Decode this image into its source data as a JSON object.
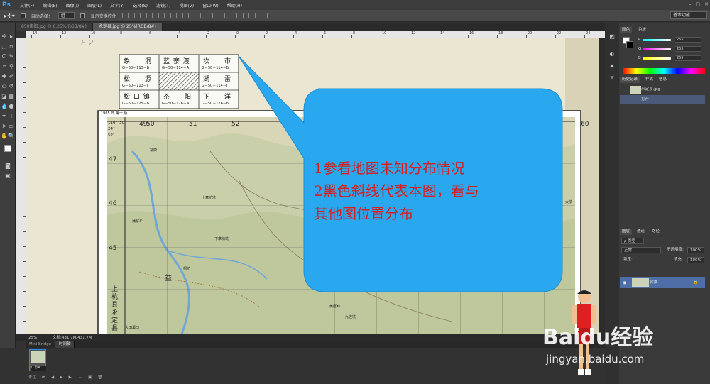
{
  "app": {
    "logo": "Ps",
    "menu": [
      "文件(F)",
      "编辑(E)",
      "图像(I)",
      "图层(L)",
      "文字(Y)",
      "选择(S)",
      "滤镜(T)",
      "视图(V)",
      "窗口(W)",
      "帮助(H)"
    ],
    "window_controls": [
      "–",
      "□",
      "✕"
    ]
  },
  "options": {
    "auto_select_label": "自动选择：",
    "auto_select_value": "组",
    "transform_label": "显示变换控件",
    "workspace": "基本功能"
  },
  "tabs": [
    {
      "label": "850崇阳.jpg @ 6.25%(RGB/8#)",
      "active": false
    },
    {
      "label": "永定县.jpg @ 25%(RGB/8#)",
      "active": true
    }
  ],
  "ruler_top": [
    "14",
    "12",
    "10",
    "8",
    "6",
    "4",
    "2",
    "0",
    "2",
    "4",
    "6",
    "8",
    "10",
    "12",
    "14",
    "16",
    "18",
    "20",
    "22",
    "24"
  ],
  "map": {
    "index_cells": [
      {
        "name": "象　　洞",
        "code": "G－50－113－Б"
      },
      {
        "name": "蓝 寨 渡",
        "code": "G－50－114－A"
      },
      {
        "name": "坎　　市",
        "code": "G－50－114－Б"
      },
      {
        "name": "松　　源",
        "code": "G－50－113－Г"
      },
      {
        "name": "",
        "code": ""
      },
      {
        "name": "湖　　雷",
        "code": "G－50－114－Г"
      },
      {
        "name": "松 口 镇",
        "code": "G－50－125－Б"
      },
      {
        "name": "茶　　阳",
        "code": "G－50－126－A"
      },
      {
        "name": "下　　洋",
        "code": "G－50－126－Б"
      }
    ],
    "year_label": "1965 年 第一 版",
    "corner_coords": [
      "116°",
      "30′",
      "24°",
      "52′"
    ],
    "grid_top": [
      "49",
      "50",
      "51",
      "52",
      "60"
    ],
    "grid_left": [
      "47",
      "46",
      "45"
    ],
    "side_text": [
      "上",
      "杭",
      "县",
      "永",
      "定",
      "县"
    ],
    "place_labels": [
      "上章坊坑",
      "下章坊坑",
      "桐坊",
      "益",
      "上杭县",
      "大田溪口",
      "蒲寨乡",
      "大侬",
      "黄厝畔",
      "九连坑",
      "寨康"
    ],
    "pencil_mark": "E 2"
  },
  "callout": {
    "line1": "1参看地图未知分布情况",
    "line2": "2黑色斜线代表本图，看与",
    "line3": "其他图位置分布",
    "color": "#29a7ef",
    "text_color": "#d81e1e"
  },
  "status": {
    "zoom": "25%",
    "doc": "文档:431.7M/431.7M"
  },
  "bottom": {
    "tabs": [
      "Mini Bridge",
      "时间轴"
    ],
    "frame_time": "0 秒▾",
    "loop": "永远"
  },
  "panels": {
    "color_tabs": [
      "颜色",
      "色板"
    ],
    "rgb": [
      {
        "ch": "R",
        "val": "255"
      },
      {
        "ch": "G",
        "val": "255"
      },
      {
        "ch": "B",
        "val": "255"
      }
    ],
    "history_tabs": [
      "历史记录",
      "样式",
      "信息"
    ],
    "history_items": [
      "永定县.jpg",
      "打开"
    ],
    "layer_tabs": [
      "图层",
      "通道",
      "路径"
    ],
    "kind": "ρ 类型",
    "blend": "正常",
    "opacity_label": "不透明度:",
    "opacity": "100%",
    "lock_label": "锁定:",
    "fill_label": "填充:",
    "fill": "100%",
    "layer_name": "背景"
  },
  "watermark": {
    "brand": "Baidu经验",
    "url": "jingyan.baidu.com"
  }
}
